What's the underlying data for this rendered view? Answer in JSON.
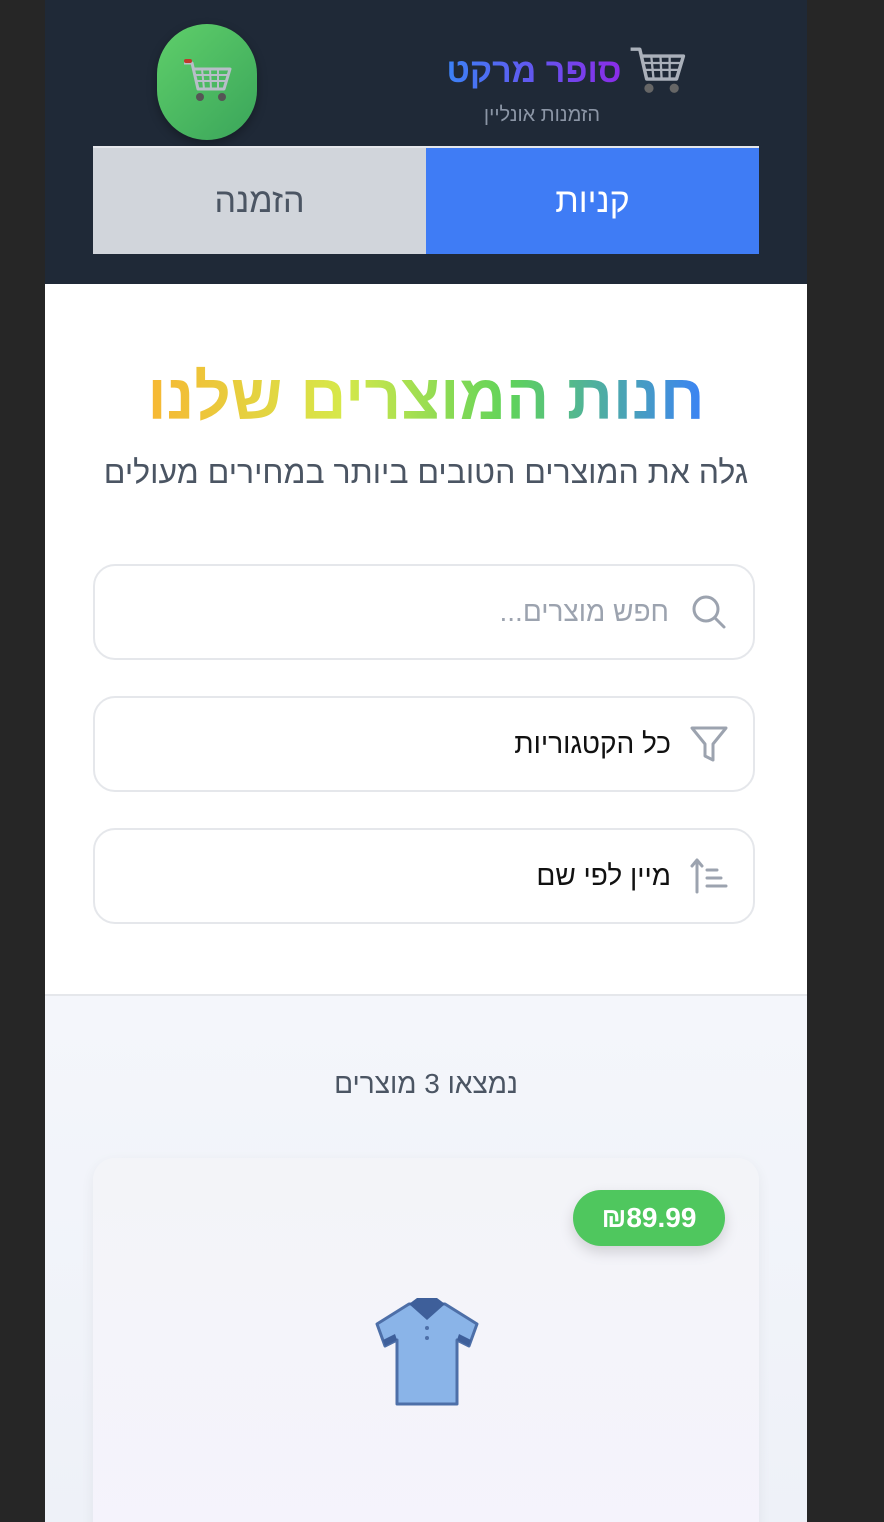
{
  "header": {
    "brand_name": "סופר מרקט",
    "brand_sub": "הזמנות אונליין",
    "cart_icon": "shopping-cart-icon",
    "tabs": [
      {
        "label": "קניות",
        "active": true
      },
      {
        "label": "הזמנה",
        "active": false
      }
    ]
  },
  "hero": {
    "title": "חנות המוצרים שלנו",
    "subtitle": "גלה את המוצרים הטובים ביותר במחירים מעולים"
  },
  "search": {
    "placeholder": "חפש מוצרים...",
    "value": "",
    "icon": "search-icon"
  },
  "category": {
    "value": "כל הקטגוריות",
    "icon": "filter-icon"
  },
  "sort": {
    "value": "מיין לפי שם",
    "icon": "sort-icon"
  },
  "products": {
    "count_text": "נמצאו 3 מוצרים",
    "items": [
      {
        "price": "₪89.99",
        "image": "shirt-icon"
      }
    ]
  },
  "colors": {
    "header_bg": "#1f2937",
    "tab_active": "#3f7cf5",
    "price_badge": "#4fc75e"
  }
}
